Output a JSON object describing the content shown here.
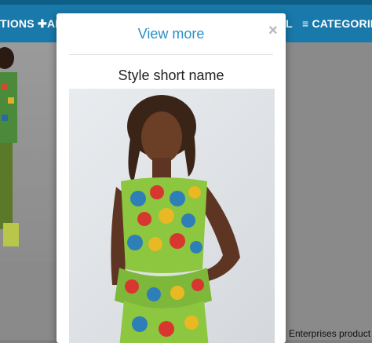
{
  "nav": {
    "left_label": "TIONS",
    "add_label": "AD",
    "right_partial": "L",
    "categories_label": "CATEGORIES",
    "plus_icon": "plus-icon",
    "menu_icon": "hamburger-menu-icon"
  },
  "background": {
    "caption": "Enterprises product"
  },
  "modal": {
    "title": "View more",
    "close_glyph": "×",
    "style_name": "Style short name",
    "image_alt": "Model wearing colorful African print dress"
  },
  "colors": {
    "nav_bg": "#1979aa",
    "title_color": "#2a8fc6",
    "overlay": "#7f7f7f"
  }
}
